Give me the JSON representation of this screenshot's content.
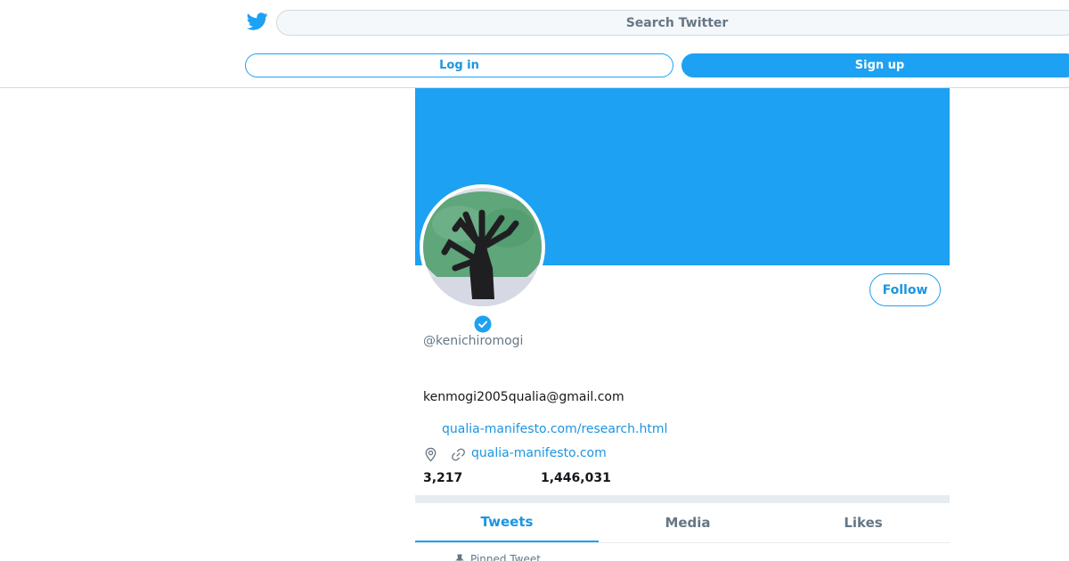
{
  "header": {
    "logo_icon": "twitter-bird-icon",
    "search_placeholder": "Search Twitter",
    "login_label": "Log in",
    "signup_label": "Sign up"
  },
  "profile": {
    "banner_color": "#1da1f2",
    "verified_icon": "verified-badge-icon",
    "handle": "@kenichiromogi",
    "bio": "kenmogi2005qualia@gmail.com",
    "bio_link": "qualia-manifesto.com/research.html",
    "location_icon": "location-pin-icon",
    "link_icon": "link-icon",
    "website": "qualia-manifesto.com",
    "following_count": "3,217",
    "followers_count": "1,446,031",
    "follow_label": "Follow"
  },
  "tabs": [
    {
      "label": "Tweets"
    },
    {
      "label": "Media"
    },
    {
      "label": "Likes"
    }
  ],
  "pinned": {
    "label": "Pinned Tweet"
  },
  "colors": {
    "accent": "#1da1f2",
    "link": "#1b95e0",
    "muted": "#657786"
  }
}
